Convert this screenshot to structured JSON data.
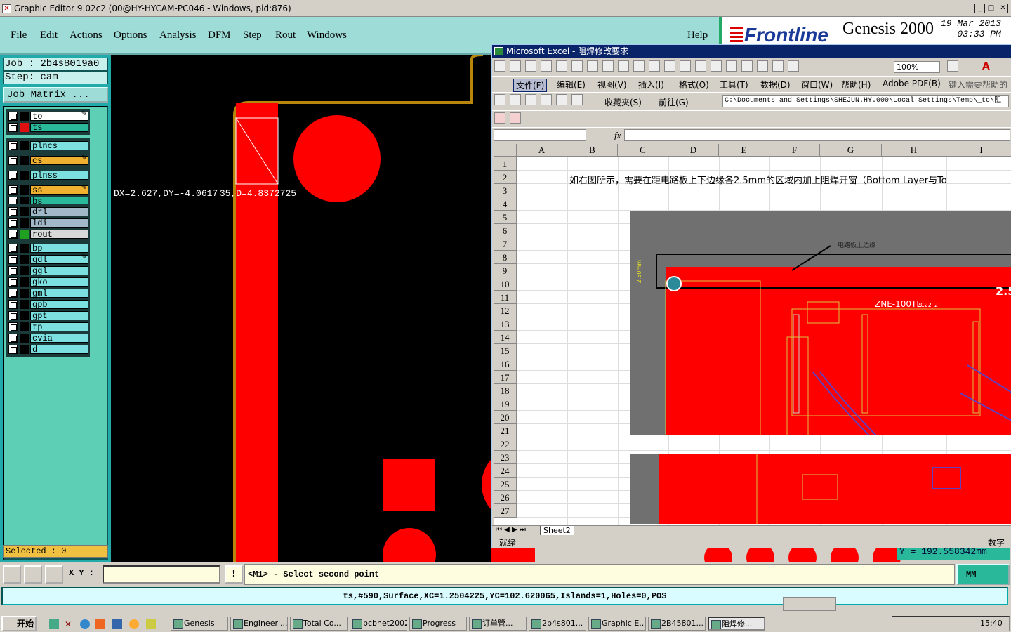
{
  "window": {
    "title": "Graphic Editor 9.02c2 (00@HY-HYCAM-PC046 - Windows, pid:876)"
  },
  "menu": [
    "File",
    "Edit",
    "Actions",
    "Options",
    "Analysis",
    "DFM",
    "Step",
    "Rout",
    "Windows"
  ],
  "help": "Help",
  "brand": {
    "logo": "Frontline",
    "product": "Genesis 2000",
    "date": "19 Mar 2013",
    "time": "03:33 PM"
  },
  "job": {
    "job_label": "Job  : 2b4s8019a0",
    "step_label": "Step: cam",
    "matrix_button": "Job Matrix ..."
  },
  "layers": [
    {
      "name": "to",
      "color": "#000000",
      "bg": "#ffffff",
      "icon": "pencil"
    },
    {
      "name": "ts",
      "color": "#e01010",
      "bg": "#2ab89a",
      "icon": "grid"
    },
    {
      "name": "plncs",
      "color": "#000000",
      "bg": "#7de0e0",
      "icon": ""
    },
    {
      "name": "cs",
      "color": "#000000",
      "bg": "#f0b030",
      "icon": "pencil"
    },
    {
      "name": "plnss",
      "color": "#000000",
      "bg": "#7de0e0",
      "icon": ""
    },
    {
      "name": "ss",
      "color": "#000000",
      "bg": "#f0b030",
      "icon": "pencil"
    },
    {
      "name": "bs",
      "color": "#000000",
      "bg": "#2ab89a",
      "icon": ""
    },
    {
      "name": "drl",
      "color": "#000000",
      "bg": "#a0b8c8",
      "icon": ""
    },
    {
      "name": "ldi",
      "color": "#000000",
      "bg": "#a0b8c8",
      "icon": ""
    },
    {
      "name": "rout",
      "color": "#20a020",
      "bg": "#d8d8d8",
      "icon": ""
    },
    {
      "name": "bp",
      "color": "#000000",
      "bg": "#7de0e0",
      "icon": ""
    },
    {
      "name": "gdl",
      "color": "#000000",
      "bg": "#7de0e0",
      "icon": "pencil"
    },
    {
      "name": "ggl",
      "color": "#000000",
      "bg": "#7de0e0",
      "icon": ""
    },
    {
      "name": "gko",
      "color": "#000000",
      "bg": "#7de0e0",
      "icon": ""
    },
    {
      "name": "gml",
      "color": "#000000",
      "bg": "#7de0e0",
      "icon": ""
    },
    {
      "name": "gpb",
      "color": "#000000",
      "bg": "#7de0e0",
      "icon": ""
    },
    {
      "name": "gpt",
      "color": "#000000",
      "bg": "#7de0e0",
      "icon": ""
    },
    {
      "name": "tp",
      "color": "#000000",
      "bg": "#7de0e0",
      "icon": ""
    },
    {
      "name": "cvia",
      "color": "#000000",
      "bg": "#7de0e0",
      "icon": ""
    },
    {
      "name": "d",
      "color": "#000000",
      "bg": "#7de0e0",
      "icon": ""
    }
  ],
  "selected": "Selected : 0",
  "measurement": "DX=2.627,DY=-4.0617 35,D=4.8372725",
  "coordinates": {
    "y": "Y = 192.558342mm"
  },
  "command": {
    "xy_label": "X Y :",
    "xy_value": "",
    "prompt": "<M1> - Select second point",
    "units": "MM"
  },
  "feature_info": "ts,#590,Surface,XC=1.2504225,YC=102.620065,Islands=1,Holes=0,POS",
  "excel": {
    "title": "Microsoft Excel - 阻焊修改要求",
    "menus": [
      "文件(F)",
      "编辑(E)",
      "视图(V)",
      "插入(I)",
      "格式(O)",
      "工具(T)",
      "数据(D)",
      "窗口(W)",
      "帮助(H)",
      "Adobe PDF(B)"
    ],
    "help_placeholder": "键入需要帮助的",
    "zoom": "100%",
    "favorites": "收藏夹(S)",
    "goto": "前往(G)",
    "path": "C:\\Documents and Settings\\SHEJUN.HY.000\\Local Settings\\Temp\\_tc\\阻",
    "fx": "fx",
    "columns": [
      "A",
      "B",
      "C",
      "D",
      "E",
      "F",
      "G",
      "H",
      "I"
    ],
    "rows": [
      "1",
      "2",
      "3",
      "4",
      "5",
      "6",
      "7",
      "8",
      "9",
      "10",
      "11",
      "12",
      "13",
      "14",
      "15",
      "16",
      "17",
      "18",
      "19",
      "20",
      "21",
      "22",
      "23",
      "24",
      "25",
      "26",
      "27"
    ],
    "cell_b2": "如右图所示，需要在距电路板上下边缘各2.5mm的区域内加上阻焊开窗（Bottom Layer与To",
    "sheet_tab": "Sheet2",
    "status": "就绪",
    "status_right": "数字",
    "pic_labels": {
      "edge": "电路板上边缘",
      "dim": "2.50mm",
      "part": "ZNE-100TL",
      "ref": "2C22_2",
      "big": "2.5"
    }
  },
  "taskbar": {
    "start": "开始",
    "tasks": [
      "Genesis",
      "Engineeri...",
      "Total Co...",
      "pcbnet2002",
      "Progress",
      "订单管...",
      "2b4s801...",
      "Graphic E...",
      "2B45801...",
      "阻焊修..."
    ],
    "clock": "15:40"
  }
}
